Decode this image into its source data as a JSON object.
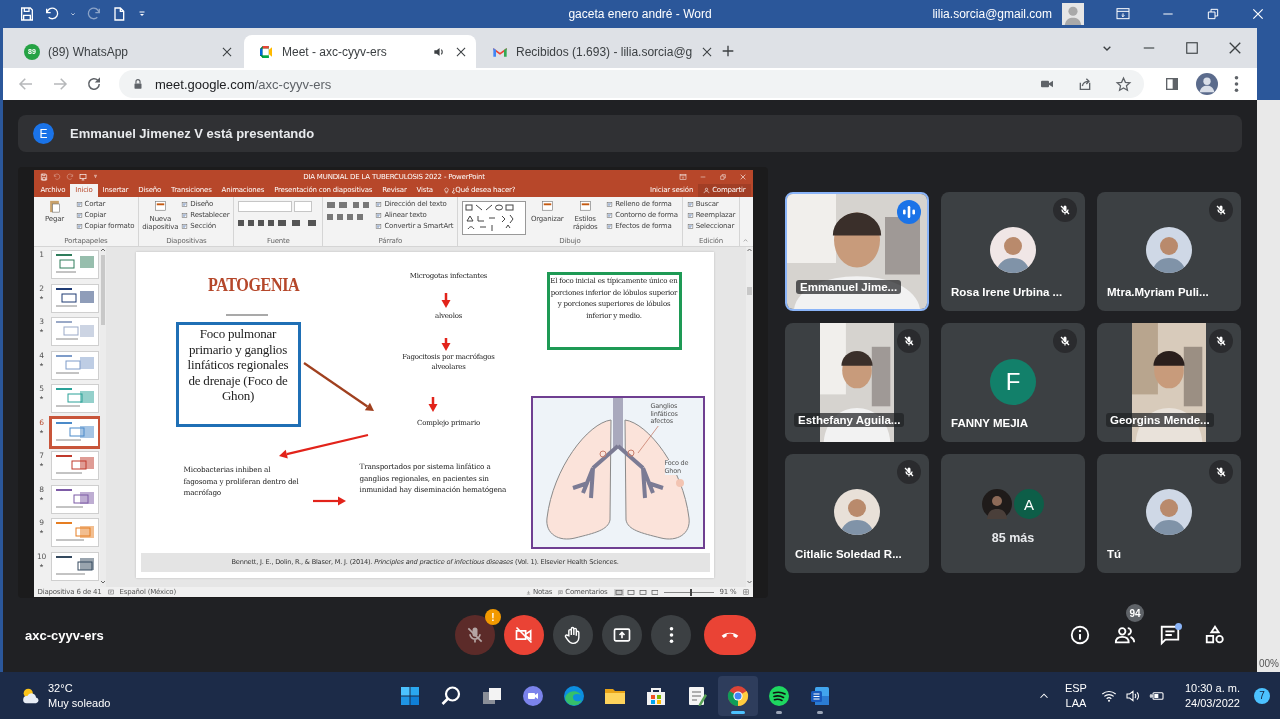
{
  "word_window": {
    "title": "gaceta enero andré  -  Word",
    "account": "lilia.sorcia@gmail.com",
    "zoom_text": "00%"
  },
  "browser": {
    "tabs": [
      {
        "title": "(89) WhatsApp",
        "kind": "whatsapp",
        "badge": "89",
        "selected": false,
        "audio": false
      },
      {
        "title": "Meet - axc-cyyv-ers",
        "kind": "meet",
        "selected": true,
        "audio": true
      },
      {
        "title": "Recibidos (1.693) - lilia.sorcia@g",
        "kind": "gmail",
        "selected": false,
        "audio": false
      }
    ],
    "address": {
      "host": "meet.google.com",
      "path": "/axc-cyyv-ers"
    }
  },
  "meet": {
    "presenter": {
      "initial": "E",
      "text": "Emmanuel Jimenez V está presentando"
    },
    "presentation": {
      "title": "DIA MUNDIAL DE LA TUBERCULOSIS 2022 - PowerPoint",
      "ribbon_tabs": [
        {
          "label": "Archivo",
          "selected": false
        },
        {
          "label": "Inicio",
          "selected": true
        },
        {
          "label": "Insertar",
          "selected": false
        },
        {
          "label": "Diseño",
          "selected": false
        },
        {
          "label": "Transiciones",
          "selected": false
        },
        {
          "label": "Animaciones",
          "selected": false
        },
        {
          "label": "Presentación con diapositivas",
          "selected": false
        },
        {
          "label": "Revisar",
          "selected": false
        },
        {
          "label": "Vista",
          "selected": false
        }
      ],
      "tell_me": "¿Qué desea hacer?",
      "sign_in": "Iniciar sesión",
      "share": "Compartir",
      "ribbon_groups": [
        {
          "name": "Portapapeles",
          "items": [
            {
              "label": "Pegar",
              "kind": "large"
            },
            {
              "label": "Cortar",
              "kind": "small"
            },
            {
              "label": "Copiar",
              "kind": "small"
            },
            {
              "label": "Copiar formato",
              "kind": "small"
            }
          ]
        },
        {
          "name": "Diapositivas",
          "items": [
            {
              "label": "Nueva diapositiva",
              "kind": "large"
            },
            {
              "label": "Diseño",
              "kind": "small"
            },
            {
              "label": "Restablecer",
              "kind": "small"
            },
            {
              "label": "Sección",
              "kind": "small"
            }
          ]
        },
        {
          "name": "Fuente",
          "items": [
            {
              "kind": "font"
            }
          ]
        },
        {
          "name": "Párrafo",
          "items": [
            {
              "kind": "paragraph"
            },
            {
              "label": "Dirección del texto",
              "kind": "small"
            },
            {
              "label": "Alinear texto",
              "kind": "small"
            },
            {
              "label": "Convertir a SmartArt",
              "kind": "small"
            }
          ]
        },
        {
          "name": "Dibujo",
          "items": [
            {
              "kind": "shapes"
            },
            {
              "label": "Organizar",
              "kind": "large"
            },
            {
              "label": "Estilos rápidos",
              "kind": "large"
            },
            {
              "label": "Relleno de forma",
              "kind": "small"
            },
            {
              "label": "Contorno de forma",
              "kind": "small"
            },
            {
              "label": "Efectos de forma",
              "kind": "small"
            }
          ]
        },
        {
          "name": "Edición",
          "items": [
            {
              "label": "Buscar",
              "kind": "small"
            },
            {
              "label": "Reemplazar",
              "kind": "small"
            },
            {
              "label": "Seleccionar",
              "kind": "small"
            }
          ]
        }
      ],
      "thumbnails": [
        {
          "number": "1",
          "selected": false,
          "transition": false
        },
        {
          "number": "2",
          "selected": false,
          "transition": true
        },
        {
          "number": "3",
          "selected": false,
          "transition": true
        },
        {
          "number": "4",
          "selected": false,
          "transition": true
        },
        {
          "number": "5",
          "selected": false,
          "transition": true
        },
        {
          "number": "6",
          "selected": true,
          "transition": true
        },
        {
          "number": "7",
          "selected": false,
          "transition": true
        },
        {
          "number": "8",
          "selected": false,
          "transition": true
        },
        {
          "number": "9",
          "selected": false,
          "transition": true
        },
        {
          "number": "10",
          "selected": false,
          "transition": true
        }
      ],
      "slide": {
        "title": "PATOGENIA",
        "focus_box": "Foco pulmonar primario y ganglios linfáticos regionales de drenaje (Foco de Ghon)",
        "steps": [
          "Microgotas infectantes",
          "alveolos",
          "Fagocitosis por macrófagos alveolares",
          "Complejo primario"
        ],
        "note_box": "El foco inicial es típicamente único en porciones inferior de lóbulos superior y porciones superiores de lóbulos inferior y medio.",
        "outcome_left": "Micobacterias inhiben al fagosoma y proliferan dentro del macrófago",
        "outcome_right": "Transportados por sistema linfático a ganglios regionales, en pacientes sin inmunidad hay diseminación hematógena",
        "figure_labels": [
          "Ganglios linfáticos afectos",
          "Foco de Ghon"
        ],
        "citation": "Bennett, J. E., Dolin, R., & Blaser, M. J. (2014). *Principles and practice of infectious diseases* (Vol. 1). Elsevier Health Sciences."
      },
      "status": {
        "slide_position": "Diapositiva 6 de 41",
        "language": "Español (México)",
        "notes": "Notas",
        "comments": "Comentarios",
        "zoom": "91 %",
        "zoom_slider": {
          "level": 0.55
        }
      }
    },
    "participants": [
      {
        "name": "Emmanuel Jime...",
        "kind": "video",
        "muted": false,
        "speaking": true
      },
      {
        "name": "Rosa Irene Urbina ...",
        "muted": true,
        "speaking": false
      },
      {
        "name": "Mtra.Myriam Puli...",
        "muted": true,
        "speaking": false
      },
      {
        "name": "Esthefany Aguila...",
        "kind": "portrait_video",
        "muted": true,
        "speaking": false
      },
      {
        "name": "FANNY MEJIA",
        "kind": "initial",
        "initial": "F",
        "color": "#12806a",
        "muted": true,
        "speaking": false
      },
      {
        "name": "Georgins Mende...",
        "kind": "portrait_video",
        "muted": true,
        "speaking": false
      },
      {
        "name": "Citlalic Soledad R...",
        "muted": true,
        "speaking": false
      },
      {
        "name": "85 más",
        "kind": "overflow",
        "initial": "A",
        "color": "#0d5e48",
        "muted": false,
        "speaking": false
      },
      {
        "name": "Tú",
        "muted": true,
        "speaking": false
      }
    ],
    "meeting_code": "axc-cyyv-ers",
    "mic": {
      "on": false,
      "badge": "!"
    },
    "camera": {
      "on": false
    },
    "buttons": [
      {
        "kind": "hand"
      },
      {
        "kind": "present"
      },
      {
        "kind": "more"
      },
      {
        "kind": "end"
      }
    ],
    "side_buttons": [
      {
        "kind": "info",
        "dot": false
      },
      {
        "kind": "people",
        "badge": "94",
        "dot": false
      },
      {
        "kind": "chat",
        "dot": true
      },
      {
        "kind": "activities",
        "dot": false
      }
    ]
  },
  "taskbar": {
    "weather": {
      "temperature": "32°C",
      "condition": "Muy soleado"
    },
    "apps": [
      {
        "kind": "start",
        "selected": false,
        "running": false
      },
      {
        "kind": "search",
        "selected": false,
        "running": false
      },
      {
        "kind": "taskview",
        "selected": false,
        "running": false
      },
      {
        "kind": "chat",
        "selected": false,
        "running": false
      },
      {
        "kind": "edge",
        "selected": false,
        "running": false
      },
      {
        "kind": "folder",
        "selected": false,
        "running": false
      },
      {
        "kind": "store",
        "selected": false,
        "running": false
      },
      {
        "kind": "notepad",
        "selected": false,
        "running": false
      },
      {
        "kind": "chrome",
        "selected": true,
        "running": true
      },
      {
        "kind": "music",
        "selected": false,
        "running": true
      },
      {
        "kind": "word",
        "selected": false,
        "running": true
      }
    ],
    "tray": {
      "language": "ESP",
      "layout": "LAA",
      "time": "10:30 a. m.",
      "date": "24/03/2022",
      "notifications": "7"
    }
  }
}
